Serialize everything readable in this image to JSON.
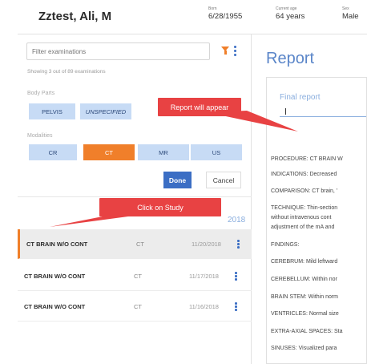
{
  "header": {
    "patient_name": "Zztest, Ali, M",
    "born_label": "Born",
    "born_value": "6/28/1955",
    "age_label": "Current age",
    "age_value": "64 years",
    "sex_label": "Sex",
    "sex_value": "Male"
  },
  "filter": {
    "placeholder": "Filter examinations",
    "showing_text": "Showing 3 out of 89 examinations"
  },
  "body_parts": {
    "label": "Body Parts",
    "items": [
      "PELVIS",
      "UNSPECIFIED"
    ]
  },
  "modalities": {
    "label": "Modalities",
    "items": [
      "CR",
      "CT",
      "MR",
      "US"
    ],
    "active": "CT"
  },
  "actions": {
    "done": "Done",
    "cancel": "Cancel"
  },
  "studies": {
    "year": "2018",
    "rows": [
      {
        "name": "CT BRAIN W/O CONT",
        "modality": "CT",
        "date": "11/20/2018"
      },
      {
        "name": "CT BRAIN W/O CONT",
        "modality": "CT",
        "date": "11/17/2018"
      },
      {
        "name": "CT BRAIN W/O CONT",
        "modality": "CT",
        "date": "11/16/2018"
      }
    ]
  },
  "report": {
    "title": "Report",
    "subtitle": "Final report",
    "lines": [
      "PROCEDURE: CT BRAIN W",
      "INDICATIONS: Decreased",
      "COMPARISON: CT brain, '",
      "TECHNIQUE: Thin-section",
      "without intravenous cont",
      "adjustment of the mA and",
      "FINDINGS:",
      "CEREBRUM: Mild leftward",
      "CEREBELLUM: Within nor",
      "BRAIN STEM: Within norm",
      "VENTRICLES: Normal size",
      "EXTRA-AXIAL SPACES: Sta",
      "SINUSES: Visualized para"
    ]
  },
  "callouts": {
    "report_will_appear": "Report will appear",
    "click_on_study": "Click on Study"
  },
  "colors": {
    "accent_orange": "#f07f2a",
    "accent_blue": "#3b6ec4",
    "chip_blue": "#c7dbf5",
    "callout_red": "#e84243"
  }
}
